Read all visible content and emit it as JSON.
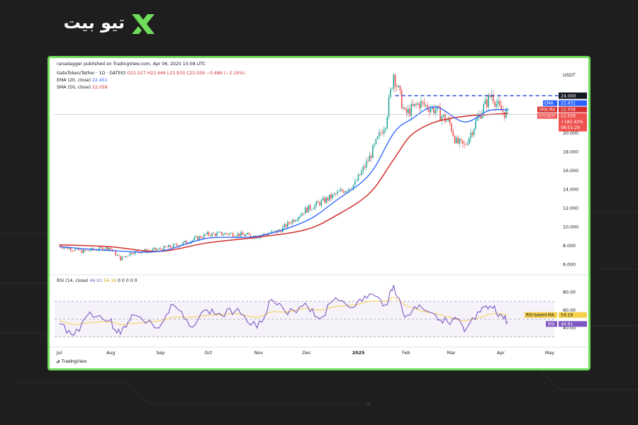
{
  "brand": {
    "logo_text": "تیو بیت",
    "icon": "tabdeal-x-icon"
  },
  "header": {
    "published": "ranadagger published on TradingView.com, Apr 06, 2025 15:08 UTC",
    "symbol": "GateToken/Tether · 1D · GATEIO",
    "ohlc": "O22.527  H22.646  L21.933  C22.029  −0.486 (−2.16%)",
    "ema_label": "EMA (20, close)",
    "ema_value": "22.451",
    "sma_label": "SMA (50, close)",
    "sma_value": "22.058",
    "rsi_label": "RSI (14, close)",
    "rsi_value": "46.91",
    "rsi_ma_value": "54.19",
    "rsi_extra": "0  0  0  0  0"
  },
  "footer": {
    "brand": "TradingView",
    "icon": "tradingview-logo-icon"
  },
  "colors": {
    "up": "#26a69a",
    "down": "#ef5350",
    "ema": "#2962ff",
    "sma": "#d32f2f",
    "rsi": "#7e57c2",
    "rsi_ma": "#f5d04a",
    "accent": "#6fdc5a"
  },
  "chart_data": {
    "type": "line",
    "title": "GateToken/Tether · 1D · GATEIO",
    "currency": "USDT",
    "x_ticks": [
      "Jul",
      "Aug",
      "Sep",
      "Oct",
      "Nov",
      "Dec",
      "2025",
      "Feb",
      "Mar",
      "Apr",
      "May"
    ],
    "y_ticks": [
      "24.000",
      "20.000",
      "18.000",
      "16.000",
      "14.000",
      "12.000",
      "10.000",
      "8.000",
      "6.000"
    ],
    "ylim": [
      5.5,
      26.5
    ],
    "resistance_level": 24.0,
    "price_labels": [
      {
        "name": "EMA",
        "value": "22.451"
      },
      {
        "name": "SMA:MA",
        "value": "22.058"
      },
      {
        "name": "GTUSDT",
        "value": "22.029",
        "extra": [
          "+182.42%",
          "08:51:29"
        ]
      }
    ],
    "price_series": {
      "name": "GTUSDT",
      "x": [
        "Jul 01",
        "Jul 15",
        "Aug 01",
        "Aug 08",
        "Aug 15",
        "Sep 01",
        "Sep 15",
        "Oct 01",
        "Oct 15",
        "Nov 01",
        "Nov 15",
        "Dec 01",
        "Dec 15",
        "Jan 01",
        "Jan 10",
        "Jan 20",
        "Jan 25",
        "Feb 01",
        "Feb 10",
        "Feb 20",
        "Mar 01",
        "Mar 05",
        "Mar 10",
        "Mar 20",
        "Mar 27",
        "Apr 01",
        "Apr 06"
      ],
      "y": [
        8.0,
        7.4,
        7.8,
        6.6,
        7.3,
        7.6,
        8.2,
        9.2,
        9.3,
        9.0,
        9.6,
        11.8,
        13.0,
        14.6,
        17.4,
        21.2,
        26.4,
        22.0,
        23.2,
        22.5,
        21.0,
        19.0,
        18.6,
        22.2,
        24.2,
        22.5,
        22.0
      ]
    },
    "series": [
      {
        "name": "EMA",
        "x": [
          "Jul 01",
          "Aug 01",
          "Sep 01",
          "Oct 01",
          "Nov 01",
          "Dec 01",
          "Dec 20",
          "Jan 10",
          "Jan 25",
          "Feb 05",
          "Feb 20",
          "Mar 10",
          "Mar 25",
          "Apr 06"
        ],
        "y": [
          7.9,
          7.5,
          7.4,
          8.8,
          9.0,
          10.6,
          12.8,
          15.6,
          20.0,
          21.5,
          22.8,
          21.2,
          22.4,
          22.5
        ]
      },
      {
        "name": "SMA",
        "x": [
          "Jul 01",
          "Aug 01",
          "Sep 01",
          "Oct 01",
          "Nov 01",
          "Dec 01",
          "Dec 20",
          "Jan 10",
          "Jan 25",
          "Feb 05",
          "Feb 20",
          "Mar 10",
          "Mar 25",
          "Apr 06"
        ],
        "y": [
          8.1,
          7.9,
          7.4,
          8.3,
          8.9,
          9.7,
          11.2,
          13.6,
          17.2,
          19.8,
          21.2,
          21.8,
          22.0,
          22.1
        ]
      }
    ],
    "rsi": {
      "yticks": [
        "80.00",
        "60.00",
        "40.00"
      ],
      "ylim": [
        25,
        90
      ],
      "levels": [
        70,
        50,
        30
      ],
      "x": [
        "Jul 01",
        "Jul 10",
        "Jul 20",
        "Aug 01",
        "Aug 08",
        "Aug 15",
        "Sep 01",
        "Sep 10",
        "Sep 20",
        "Oct 01",
        "Oct 10",
        "Oct 20",
        "Nov 01",
        "Nov 10",
        "Nov 20",
        "Dec 01",
        "Dec 10",
        "Dec 20",
        "Jan 01",
        "Jan 10",
        "Jan 20",
        "Jan 25",
        "Feb 01",
        "Feb 10",
        "Feb 20",
        "Mar 01",
        "Mar 05",
        "Mar 10",
        "Mar 20",
        "Mar 27",
        "Apr 01",
        "Apr 06"
      ],
      "y": [
        45,
        32,
        58,
        48,
        33,
        55,
        40,
        66,
        42,
        60,
        54,
        62,
        40,
        72,
        55,
        68,
        50,
        74,
        64,
        78,
        66,
        88,
        52,
        66,
        55,
        44,
        50,
        36,
        58,
        63,
        55,
        47
      ],
      "ma_name": "RSI-based MA",
      "ma_y": [
        48,
        44,
        46,
        47,
        44,
        45,
        48,
        52,
        52,
        54,
        55,
        56,
        52,
        58,
        58,
        62,
        60,
        64,
        66,
        70,
        70,
        74,
        66,
        60,
        56,
        52,
        50,
        48,
        52,
        56,
        56,
        54
      ]
    }
  }
}
